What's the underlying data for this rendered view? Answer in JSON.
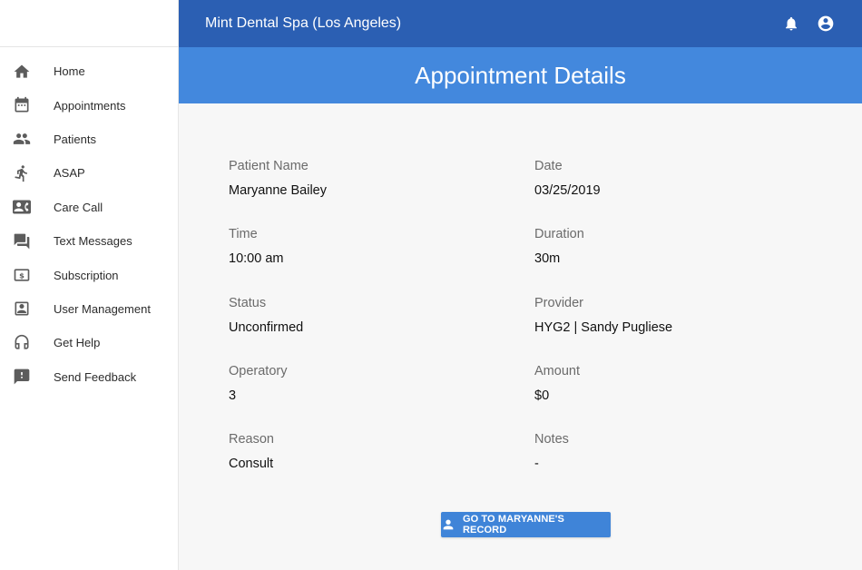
{
  "app": {
    "title": "Mint Dental Spa (Los Angeles)"
  },
  "sidebar": {
    "items": [
      {
        "label": "Home",
        "icon": "home-icon"
      },
      {
        "label": "Appointments",
        "icon": "calendar-icon"
      },
      {
        "label": "Patients",
        "icon": "people-icon"
      },
      {
        "label": "ASAP",
        "icon": "running-person-icon"
      },
      {
        "label": "Care Call",
        "icon": "contact-card-icon"
      },
      {
        "label": "Text Messages",
        "icon": "chat-bubbles-icon"
      },
      {
        "label": "Subscription",
        "icon": "dollar-card-icon"
      },
      {
        "label": "User Management",
        "icon": "user-box-icon"
      },
      {
        "label": "Get Help",
        "icon": "headset-icon"
      },
      {
        "label": "Send Feedback",
        "icon": "feedback-icon"
      }
    ]
  },
  "header": {
    "notification_icon": "bell-icon",
    "account_icon": "account-circle-icon"
  },
  "page": {
    "title": "Appointment Details"
  },
  "details": {
    "patient_name": {
      "label": "Patient Name",
      "value": "Maryanne Bailey"
    },
    "date": {
      "label": "Date",
      "value": "03/25/2019"
    },
    "time": {
      "label": "Time",
      "value": "10:00 am"
    },
    "duration": {
      "label": "Duration",
      "value": "30m"
    },
    "status": {
      "label": "Status",
      "value": "Unconfirmed"
    },
    "provider": {
      "label": "Provider",
      "value": "HYG2 | Sandy Pugliese"
    },
    "operatory": {
      "label": "Operatory",
      "value": "3"
    },
    "amount": {
      "label": "Amount",
      "value": "$0"
    },
    "reason": {
      "label": "Reason",
      "value": "Consult"
    },
    "notes": {
      "label": "Notes",
      "value": "-"
    }
  },
  "actions": {
    "record_button": "GO TO MARYANNE'S RECORD",
    "record_icon": "person-icon"
  },
  "colors": {
    "topbar": "#2b5fb3",
    "page_header": "#4388dd",
    "button": "#3f84d8",
    "content_bg": "#f7f7f7"
  }
}
